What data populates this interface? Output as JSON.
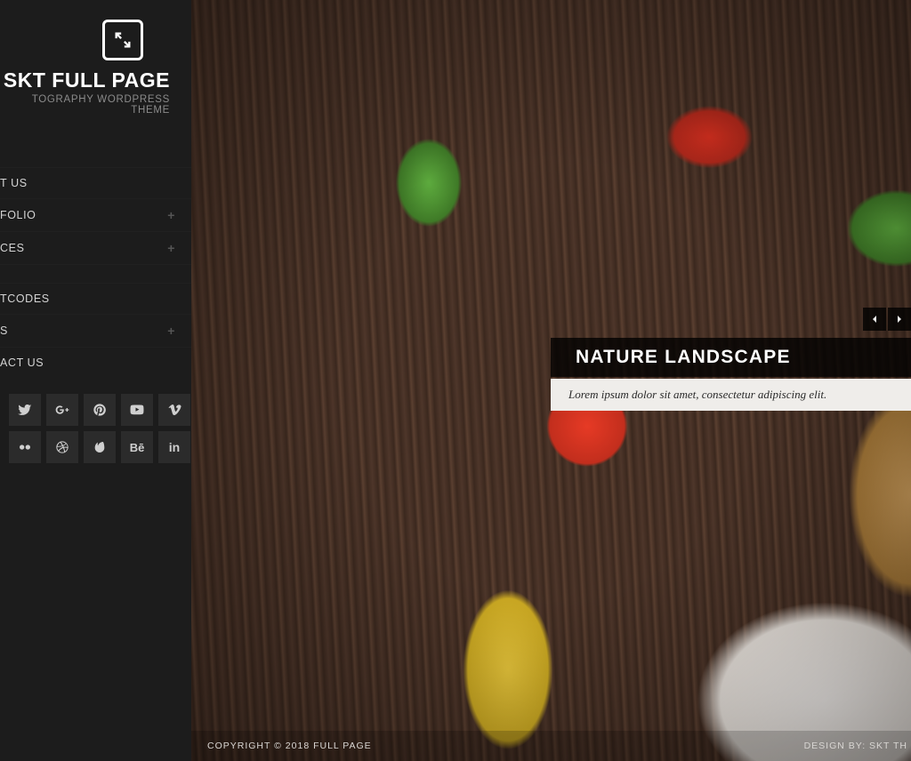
{
  "brand": {
    "title": "SKT FULL PAGE",
    "subtitle": "TOGRAPHY WORDPRESS THEME"
  },
  "nav": {
    "items": [
      {
        "label": "T US",
        "expandable": false
      },
      {
        "label": "FOLIO",
        "expandable": true
      },
      {
        "label": "CES",
        "expandable": true
      },
      {
        "label": "",
        "expandable": false
      },
      {
        "label": "TCODES",
        "expandable": false
      },
      {
        "label": "S",
        "expandable": true
      },
      {
        "label": "ACT US",
        "expandable": false
      }
    ]
  },
  "social": {
    "icons": [
      "twitter",
      "google-plus",
      "pinterest",
      "youtube",
      "vimeo",
      "flickr",
      "dribbble",
      "envato",
      "behance",
      "linkedin"
    ]
  },
  "slide": {
    "title": "NATURE LANDSCAPE",
    "subtitle": "Lorem ipsum dolor sit amet, consectetur adipiscing elit."
  },
  "footer": {
    "copyright": "COPYRIGHT © 2018 FULL PAGE",
    "design": "DESIGN BY: SKT TH"
  }
}
